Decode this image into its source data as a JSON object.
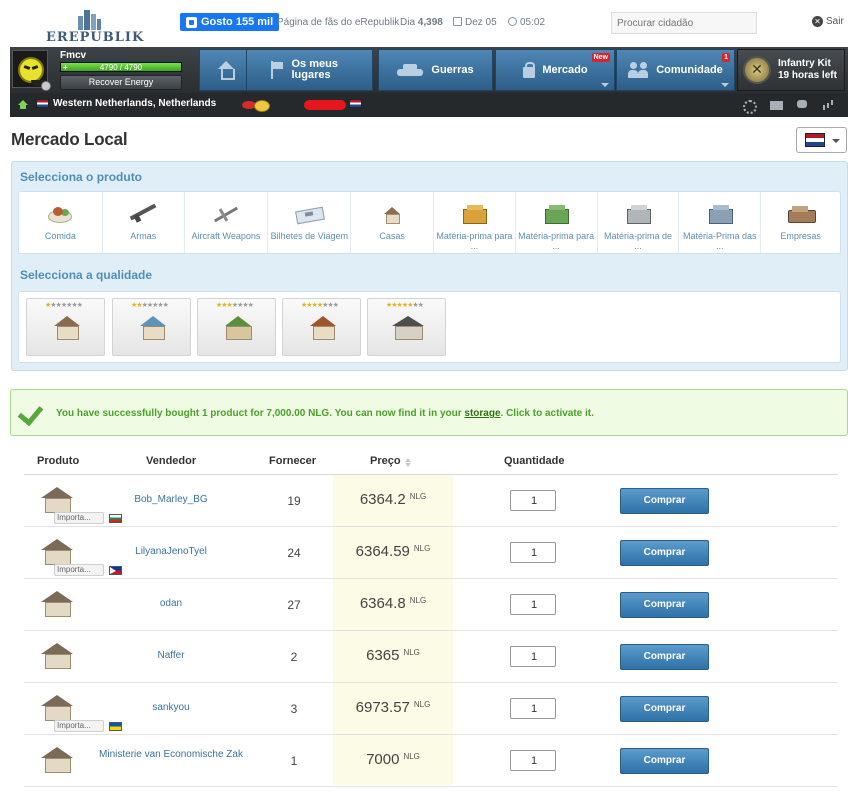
{
  "topbar": {
    "logo_text": "EREPUBLIK",
    "fb_like": "Gosto 155 mil",
    "fans_link": "Página de fãs do eRepublik",
    "day_label": "Dia",
    "day_value": "4,398",
    "date": "Dez 05",
    "time": "05:02",
    "search_placeholder": "Procurar cidadão",
    "logout": "Sair"
  },
  "player": {
    "name": "Fmcv",
    "energy_mark": "+",
    "energy_text": "4790 / 4790",
    "energy_fraction": 1.0,
    "recover_label": "Recover Energy",
    "location": "Western Netherlands, Netherlands"
  },
  "nav": {
    "places": "Os meus lugares",
    "wars": "Guerras",
    "market": "Mercado",
    "market_badge": "New",
    "community": "Comunidade",
    "community_badge": "1",
    "kit_title": "Infantry Kit",
    "kit_timer": "19 horas left"
  },
  "page": {
    "title": "Mercado Local",
    "select_product": "Selecciona o produto",
    "select_quality": "Selecciona a qualidade"
  },
  "products": [
    {
      "label": "Comida",
      "icon": "food-icon"
    },
    {
      "label": "Armas",
      "icon": "weapon-icon"
    },
    {
      "label": "Aircraft Weapons",
      "icon": "aircraft-weapon-icon"
    },
    {
      "label": "Bilhetes de Viagem",
      "icon": "ticket-icon"
    },
    {
      "label": "Casas",
      "icon": "house-icon"
    },
    {
      "label": "Matéria-prima para ...",
      "icon": "food-raw-icon"
    },
    {
      "label": "Matéria-prima para ...",
      "icon": "weapon-raw-icon"
    },
    {
      "label": "Matéria-prima de ...",
      "icon": "house-raw-icon"
    },
    {
      "label": "Matéria-Prima das ...",
      "icon": "aircraft-raw-icon"
    },
    {
      "label": "Empresas",
      "icon": "companies-icon"
    }
  ],
  "qualities": [
    {
      "level": 1,
      "stars_on": "★",
      "stars_off": "★★★★★★"
    },
    {
      "level": 2,
      "stars_on": "★★",
      "stars_off": "★★★★★"
    },
    {
      "level": 3,
      "stars_on": "★★★",
      "stars_off": "★★★★"
    },
    {
      "level": 4,
      "stars_on": "★★★★",
      "stars_off": "★★★"
    },
    {
      "level": 5,
      "stars_on": "★★★★★",
      "stars_off": "★★"
    }
  ],
  "success": {
    "before": "You have successfully bought 1 product for 7,000.00 NLG. You can now find it in your ",
    "storage": "storage",
    "after": ". Click to activate it."
  },
  "table": {
    "headers": {
      "product": "Produto",
      "seller": "Vendedor",
      "supply": "Fornecer",
      "price": "Preço",
      "quantity": "Quantidade"
    },
    "import_label": "Importa...",
    "buy_label": "Comprar",
    "rows": [
      {
        "seller": "Bob_Marley_BG",
        "supply": "19",
        "price": "6364.2",
        "currency": "NLG",
        "quantity": "1",
        "imported": true,
        "origin_flag": "flag-bg"
      },
      {
        "seller": "LilyanaJenoTyel",
        "supply": "24",
        "price": "6364.59",
        "currency": "NLG",
        "quantity": "1",
        "imported": true,
        "origin_flag": "flag-ph"
      },
      {
        "seller": "odan",
        "supply": "27",
        "price": "6364.8",
        "currency": "NLG",
        "quantity": "1",
        "imported": false,
        "origin_flag": ""
      },
      {
        "seller": "Naffer",
        "supply": "2",
        "price": "6365",
        "currency": "NLG",
        "quantity": "1",
        "imported": false,
        "origin_flag": ""
      },
      {
        "seller": "sankyou",
        "supply": "3",
        "price": "6973.57",
        "currency": "NLG",
        "quantity": "1",
        "imported": true,
        "origin_flag": "flag-ua"
      },
      {
        "seller": "Ministerie van Economische Zak",
        "supply": "1",
        "price": "7000",
        "currency": "NLG",
        "quantity": "1",
        "imported": false,
        "origin_flag": ""
      }
    ]
  },
  "colors": {
    "nav_blue": "#3a6f9b",
    "buy_blue": "#3f84b9",
    "success_green": "#4aa22b",
    "price_highlight": "#fbfbe6",
    "link_blue": "#39749d"
  }
}
